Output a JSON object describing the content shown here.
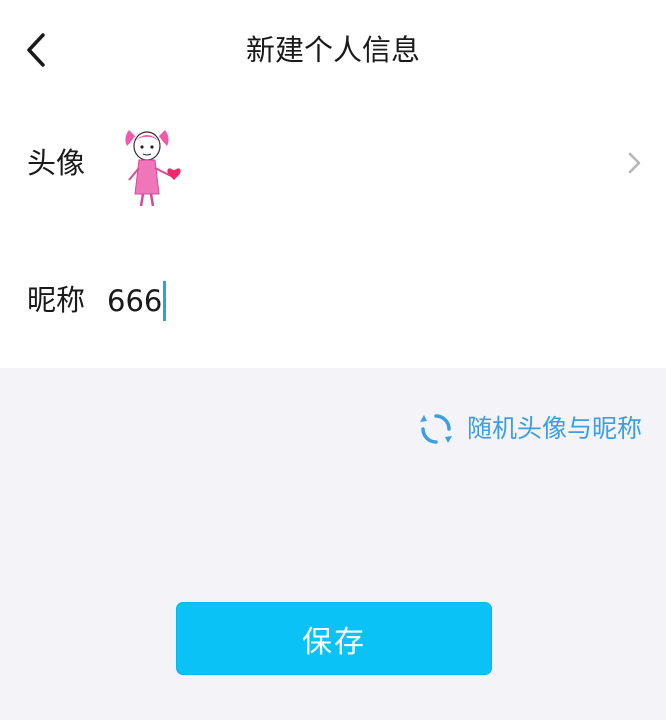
{
  "header": {
    "title": "新建个人信息",
    "back_icon": "chevron-left-icon"
  },
  "avatar_row": {
    "label": "头像",
    "avatar_icon": "avatar-image",
    "chevron_icon": "chevron-right-icon"
  },
  "nickname_row": {
    "label": "昵称",
    "value": "666"
  },
  "random": {
    "label": "随机头像与昵称",
    "icon": "refresh-icon",
    "color": "#3b9fe3"
  },
  "save": {
    "label": "保存",
    "color": "#0ac2f5"
  }
}
